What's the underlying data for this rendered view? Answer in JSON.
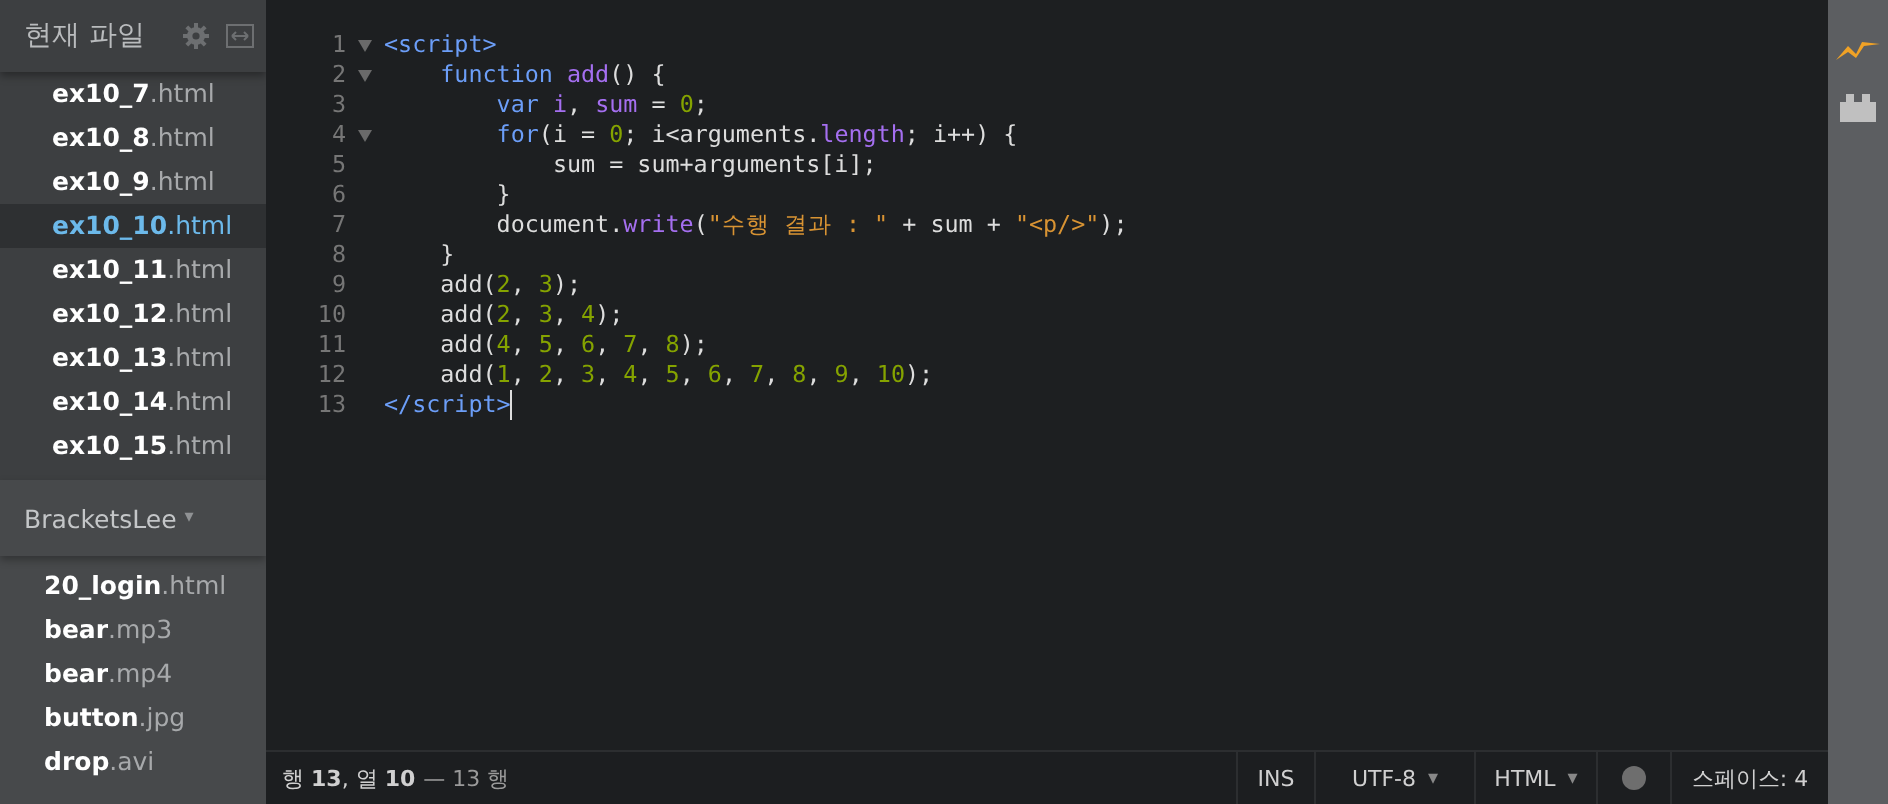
{
  "working_files": {
    "title": "현재 파일",
    "files": [
      {
        "name": "ex10_7",
        "ext": ".html",
        "selected": false
      },
      {
        "name": "ex10_8",
        "ext": ".html",
        "selected": false
      },
      {
        "name": "ex10_9",
        "ext": ".html",
        "selected": false
      },
      {
        "name": "ex10_10",
        "ext": ".html",
        "selected": true
      },
      {
        "name": "ex10_11",
        "ext": ".html",
        "selected": false
      },
      {
        "name": "ex10_12",
        "ext": ".html",
        "selected": false
      },
      {
        "name": "ex10_13",
        "ext": ".html",
        "selected": false
      },
      {
        "name": "ex10_14",
        "ext": ".html",
        "selected": false
      },
      {
        "name": "ex10_15",
        "ext": ".html",
        "selected": false
      }
    ]
  },
  "project": {
    "title": "BracketsLee",
    "caret": "▾",
    "files": [
      {
        "name": "20_login",
        "ext": ".html"
      },
      {
        "name": "bear",
        "ext": ".mp3"
      },
      {
        "name": "bear",
        "ext": ".mp4"
      },
      {
        "name": "button",
        "ext": ".jpg"
      },
      {
        "name": "drop",
        "ext": ".avi"
      }
    ]
  },
  "editor": {
    "lines": [
      {
        "number": "1",
        "fold": true,
        "tokens": [
          {
            "kind": "tag",
            "t": "<script>"
          }
        ]
      },
      {
        "number": "2",
        "fold": true,
        "tokens": [
          {
            "kind": "keyword",
            "t": "    function "
          },
          {
            "kind": "def",
            "t": "add"
          },
          {
            "kind": "plain",
            "t": "() {"
          }
        ]
      },
      {
        "number": "3",
        "fold": false,
        "tokens": [
          {
            "kind": "keyword",
            "t": "        var "
          },
          {
            "kind": "def",
            "t": "i"
          },
          {
            "kind": "plain",
            "t": ", "
          },
          {
            "kind": "def",
            "t": "sum"
          },
          {
            "kind": "plain",
            "t": " = "
          },
          {
            "kind": "number",
            "t": "0"
          },
          {
            "kind": "plain",
            "t": ";"
          }
        ]
      },
      {
        "number": "4",
        "fold": true,
        "tokens": [
          {
            "kind": "keyword",
            "t": "        for"
          },
          {
            "kind": "plain",
            "t": "(i = "
          },
          {
            "kind": "number",
            "t": "0"
          },
          {
            "kind": "plain",
            "t": "; i<arguments."
          },
          {
            "kind": "def",
            "t": "length"
          },
          {
            "kind": "plain",
            "t": "; i++) {"
          }
        ]
      },
      {
        "number": "5",
        "fold": false,
        "tokens": [
          {
            "kind": "plain",
            "t": "            sum = sum+arguments[i];"
          }
        ]
      },
      {
        "number": "6",
        "fold": false,
        "tokens": [
          {
            "kind": "plain",
            "t": "        }"
          }
        ]
      },
      {
        "number": "7",
        "fold": false,
        "tokens": [
          {
            "kind": "plain",
            "t": "        document."
          },
          {
            "kind": "def",
            "t": "write"
          },
          {
            "kind": "plain",
            "t": "("
          },
          {
            "kind": "string",
            "t": "\"수행 결과 : \""
          },
          {
            "kind": "plain",
            "t": " + sum + "
          },
          {
            "kind": "string",
            "t": "\"<p/>\""
          },
          {
            "kind": "plain",
            "t": ");"
          }
        ]
      },
      {
        "number": "8",
        "fold": false,
        "tokens": [
          {
            "kind": "plain",
            "t": "    }"
          }
        ]
      },
      {
        "number": "9",
        "fold": false,
        "tokens": [
          {
            "kind": "plain",
            "t": "    add("
          },
          {
            "kind": "number",
            "t": "2"
          },
          {
            "kind": "plain",
            "t": ", "
          },
          {
            "kind": "number",
            "t": "3"
          },
          {
            "kind": "plain",
            "t": ");"
          }
        ]
      },
      {
        "number": "10",
        "fold": false,
        "tokens": [
          {
            "kind": "plain",
            "t": "    add("
          },
          {
            "kind": "number",
            "t": "2"
          },
          {
            "kind": "plain",
            "t": ", "
          },
          {
            "kind": "number",
            "t": "3"
          },
          {
            "kind": "plain",
            "t": ", "
          },
          {
            "kind": "number",
            "t": "4"
          },
          {
            "kind": "plain",
            "t": ");"
          }
        ]
      },
      {
        "number": "11",
        "fold": false,
        "tokens": [
          {
            "kind": "plain",
            "t": "    add("
          },
          {
            "kind": "number",
            "t": "4"
          },
          {
            "kind": "plain",
            "t": ", "
          },
          {
            "kind": "number",
            "t": "5"
          },
          {
            "kind": "plain",
            "t": ", "
          },
          {
            "kind": "number",
            "t": "6"
          },
          {
            "kind": "plain",
            "t": ", "
          },
          {
            "kind": "number",
            "t": "7"
          },
          {
            "kind": "plain",
            "t": ", "
          },
          {
            "kind": "number",
            "t": "8"
          },
          {
            "kind": "plain",
            "t": ");"
          }
        ]
      },
      {
        "number": "12",
        "fold": false,
        "tokens": [
          {
            "kind": "plain",
            "t": "    add("
          },
          {
            "kind": "number",
            "t": "1"
          },
          {
            "kind": "plain",
            "t": ", "
          },
          {
            "kind": "number",
            "t": "2"
          },
          {
            "kind": "plain",
            "t": ", "
          },
          {
            "kind": "number",
            "t": "3"
          },
          {
            "kind": "plain",
            "t": ", "
          },
          {
            "kind": "number",
            "t": "4"
          },
          {
            "kind": "plain",
            "t": ", "
          },
          {
            "kind": "number",
            "t": "5"
          },
          {
            "kind": "plain",
            "t": ", "
          },
          {
            "kind": "number",
            "t": "6"
          },
          {
            "kind": "plain",
            "t": ", "
          },
          {
            "kind": "number",
            "t": "7"
          },
          {
            "kind": "plain",
            "t": ", "
          },
          {
            "kind": "number",
            "t": "8"
          },
          {
            "kind": "plain",
            "t": ", "
          },
          {
            "kind": "number",
            "t": "9"
          },
          {
            "kind": "plain",
            "t": ", "
          },
          {
            "kind": "number",
            "t": "10"
          },
          {
            "kind": "plain",
            "t": ");"
          }
        ]
      },
      {
        "number": "13",
        "fold": false,
        "tokens": [
          {
            "kind": "tag",
            "t": "</script>"
          }
        ]
      }
    ]
  },
  "status_bar": {
    "position": "행 **13**, 열 **10**",
    "line_count": "— 13 행",
    "mode": "INS",
    "encoding": "UTF-8",
    "language": "HTML",
    "caret": "▾",
    "indent": "스페이스: 4"
  }
}
